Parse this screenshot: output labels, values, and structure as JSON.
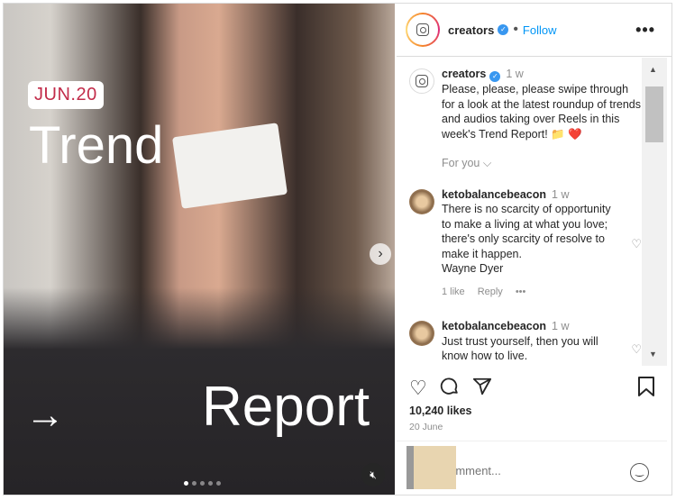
{
  "media": {
    "date_badge": "JUN.20",
    "title_top": "Trend",
    "title_bottom": "Report",
    "arrow": "→",
    "slide_count": 5,
    "active_slide": 1
  },
  "header": {
    "username": "creators",
    "verified": true,
    "follow_label": "Follow",
    "more_label": "•••"
  },
  "caption": {
    "username": "creators",
    "time": "1 w",
    "text": "Please, please, please swipe through for a look at the latest roundup of trends and audios taking over Reels in this week's Trend Report! 📁 ❤️",
    "filter_label": "For you ⌵"
  },
  "comments": [
    {
      "username": "ketobalancebeacon",
      "time": "1 w",
      "text": "There is no scarcity of opportunity to make a living at what you love; there's only scarcity of resolve to make it happen.\nWayne Dyer",
      "likes": "1 like",
      "reply": "Reply",
      "more": "•••"
    },
    {
      "username": "ketobalancebeacon",
      "time": "1 w",
      "text": "Just trust yourself, then you will know how to live."
    }
  ],
  "post": {
    "likes": "10,240 likes",
    "date": "20 June"
  },
  "comment_input": {
    "placeholder": "Add a comment..."
  },
  "colors": {
    "accent": "#0095f6",
    "verified": "#3897f0"
  }
}
